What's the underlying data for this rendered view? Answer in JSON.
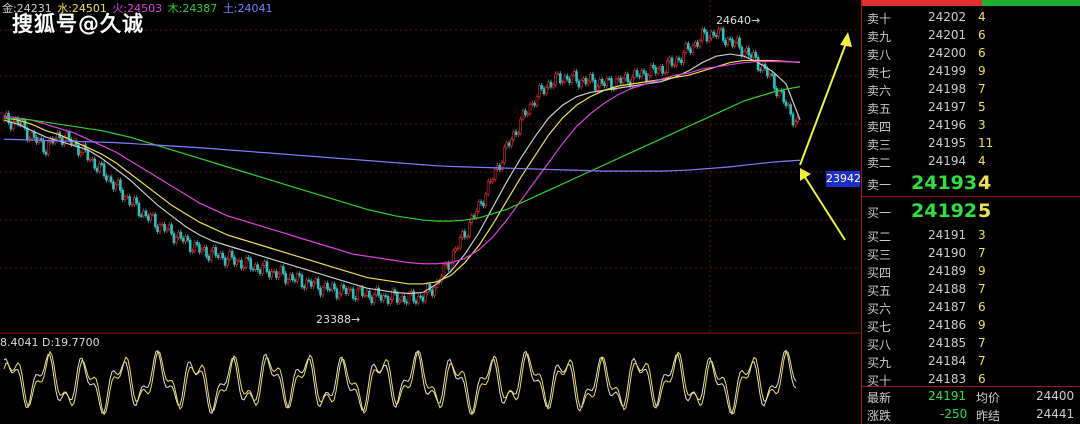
{
  "ma_legend": [
    {
      "label": "金:24231",
      "color": "#cccccc"
    },
    {
      "label": "水:24501",
      "color": "#f0e050"
    },
    {
      "label": "火:24503",
      "color": "#e040e0"
    },
    {
      "label": "木:24387",
      "color": "#30d030"
    },
    {
      "label": "土:24041",
      "color": "#8080ff"
    }
  ],
  "watermark": "搜狐号@久诚",
  "peak_label": "24640→",
  "low_label": "23388→",
  "price_tag": "23942",
  "osc_legend": "8.4041 D:19.7700",
  "colors": {
    "up": "#e03030",
    "down": "#30c0c0",
    "bid_big": "#30e040",
    "vol": "#f0e050",
    "tag_bg": "#1c2fc8"
  },
  "order_book": {
    "asks": [
      {
        "label": "卖十",
        "price": "24202",
        "vol": "4"
      },
      {
        "label": "卖九",
        "price": "24201",
        "vol": "6"
      },
      {
        "label": "卖八",
        "price": "24200",
        "vol": "6"
      },
      {
        "label": "卖七",
        "price": "24199",
        "vol": "9"
      },
      {
        "label": "卖六",
        "price": "24198",
        "vol": "7"
      },
      {
        "label": "卖五",
        "price": "24197",
        "vol": "5"
      },
      {
        "label": "卖四",
        "price": "24196",
        "vol": "3"
      },
      {
        "label": "卖三",
        "price": "24195",
        "vol": "11"
      },
      {
        "label": "卖二",
        "price": "24194",
        "vol": "4"
      },
      {
        "label": "卖一",
        "price": "24193",
        "vol": "4"
      }
    ],
    "bids": [
      {
        "label": "买一",
        "price": "24192",
        "vol": "5"
      },
      {
        "label": "买二",
        "price": "24191",
        "vol": "3"
      },
      {
        "label": "买三",
        "price": "24190",
        "vol": "7"
      },
      {
        "label": "买四",
        "price": "24189",
        "vol": "9"
      },
      {
        "label": "买五",
        "price": "24188",
        "vol": "7"
      },
      {
        "label": "买六",
        "price": "24187",
        "vol": "6"
      },
      {
        "label": "买七",
        "price": "24186",
        "vol": "9"
      },
      {
        "label": "买八",
        "price": "24185",
        "vol": "7"
      },
      {
        "label": "买九",
        "price": "24184",
        "vol": "7"
      },
      {
        "label": "买十",
        "price": "24183",
        "vol": "6"
      }
    ],
    "footer": {
      "last_label": "最新",
      "last": "24191",
      "avg_label": "均价",
      "avg": "24400",
      "chg_label": "涨跌",
      "chg": "-250",
      "prev_label": "昨结",
      "prev": "24441"
    }
  },
  "chart_data": {
    "type": "line",
    "price_high": 24640,
    "price_low": 23388,
    "price_marker": 23942,
    "close": [
      24230,
      24220,
      24150,
      24100,
      24160,
      24120,
      24060,
      23990,
      23920,
      23850,
      23790,
      23740,
      23700,
      23660,
      23620,
      23600,
      23580,
      23560,
      23540,
      23520,
      23500,
      23480,
      23460,
      23440,
      23430,
      23420,
      23410,
      23400,
      23395,
      23390,
      23400,
      23460,
      23580,
      23700,
      23820,
      23960,
      24100,
      24220,
      24330,
      24400,
      24430,
      24420,
      24410,
      24400,
      24410,
      24430,
      24450,
      24470,
      24500,
      24560,
      24620,
      24640,
      24600,
      24560,
      24500,
      24420,
      24300,
      24191
    ],
    "lines": [
      {
        "name": "金",
        "color": "#cccccc",
        "values": [
          24230,
          24210,
          24180,
          24150,
          24130,
          24110,
          24090,
          24050,
          24000,
          23950,
          23890,
          23830,
          23780,
          23730,
          23690,
          23660,
          23640,
          23620,
          23600,
          23580,
          23560,
          23540,
          23520,
          23500,
          23480,
          23460,
          23440,
          23430,
          23420,
          23415,
          23420,
          23460,
          23520,
          23600,
          23700,
          23820,
          23940,
          24050,
          24150,
          24240,
          24300,
          24340,
          24360,
          24370,
          24380,
          24390,
          24400,
          24410,
          24430,
          24460,
          24500,
          24530,
          24540,
          24530,
          24500,
          24460,
          24400,
          24231
        ]
      },
      {
        "name": "水",
        "color": "#f0e050",
        "values": [
          24240,
          24230,
          24210,
          24180,
          24160,
          24130,
          24100,
          24070,
          24030,
          23980,
          23930,
          23880,
          23830,
          23790,
          23750,
          23720,
          23690,
          23670,
          23650,
          23630,
          23610,
          23590,
          23570,
          23550,
          23530,
          23510,
          23490,
          23480,
          23470,
          23460,
          23460,
          23470,
          23500,
          23560,
          23640,
          23740,
          23850,
          23960,
          24060,
          24160,
          24240,
          24300,
          24340,
          24370,
          24390,
          24400,
          24410,
          24420,
          24430,
          24440,
          24460,
          24480,
          24500,
          24510,
          24510,
          24510,
          24505,
          24501
        ]
      },
      {
        "name": "火",
        "color": "#e040e0",
        "values": [
          24250,
          24240,
          24230,
          24210,
          24190,
          24170,
          24140,
          24110,
          24080,
          24040,
          24000,
          23960,
          23920,
          23880,
          23840,
          23810,
          23780,
          23760,
          23740,
          23720,
          23700,
          23680,
          23660,
          23640,
          23620,
          23600,
          23590,
          23580,
          23570,
          23560,
          23555,
          23555,
          23560,
          23580,
          23620,
          23680,
          23760,
          23850,
          23940,
          24030,
          24120,
          24200,
          24260,
          24310,
          24350,
          24380,
          24400,
          24420,
          24440,
          24450,
          24470,
          24480,
          24490,
          24500,
          24505,
          24505,
          24504,
          24503
        ]
      },
      {
        "name": "木",
        "color": "#30d030",
        "values": [
          24240,
          24235,
          24230,
          24220,
          24210,
          24200,
          24190,
          24180,
          24165,
          24150,
          24130,
          24110,
          24090,
          24070,
          24050,
          24030,
          24010,
          23990,
          23970,
          23950,
          23930,
          23910,
          23890,
          23870,
          23850,
          23830,
          23810,
          23795,
          23780,
          23770,
          23760,
          23755,
          23755,
          23760,
          23770,
          23790,
          23810,
          23840,
          23870,
          23900,
          23930,
          23960,
          23990,
          24020,
          24050,
          24080,
          24110,
          24140,
          24170,
          24200,
          24230,
          24260,
          24290,
          24320,
          24340,
          24360,
          24375,
          24387
        ]
      },
      {
        "name": "土",
        "color": "#8080ff",
        "values": [
          24140,
          24138,
          24136,
          24134,
          24132,
          24130,
          24128,
          24126,
          24124,
          24120,
          24116,
          24112,
          24108,
          24104,
          24100,
          24095,
          24090,
          24085,
          24080,
          24075,
          24070,
          24065,
          24060,
          24055,
          24050,
          24045,
          24040,
          24035,
          24030,
          24025,
          24020,
          24015,
          24012,
          24010,
          24008,
          24006,
          24004,
          24002,
          24000,
          23998,
          23996,
          23994,
          23992,
          23990,
          23990,
          23990,
          23990,
          23990,
          23992,
          23995,
          24000,
          24005,
          24010,
          24018,
          24025,
          24032,
          24037,
          24041
        ]
      }
    ]
  }
}
